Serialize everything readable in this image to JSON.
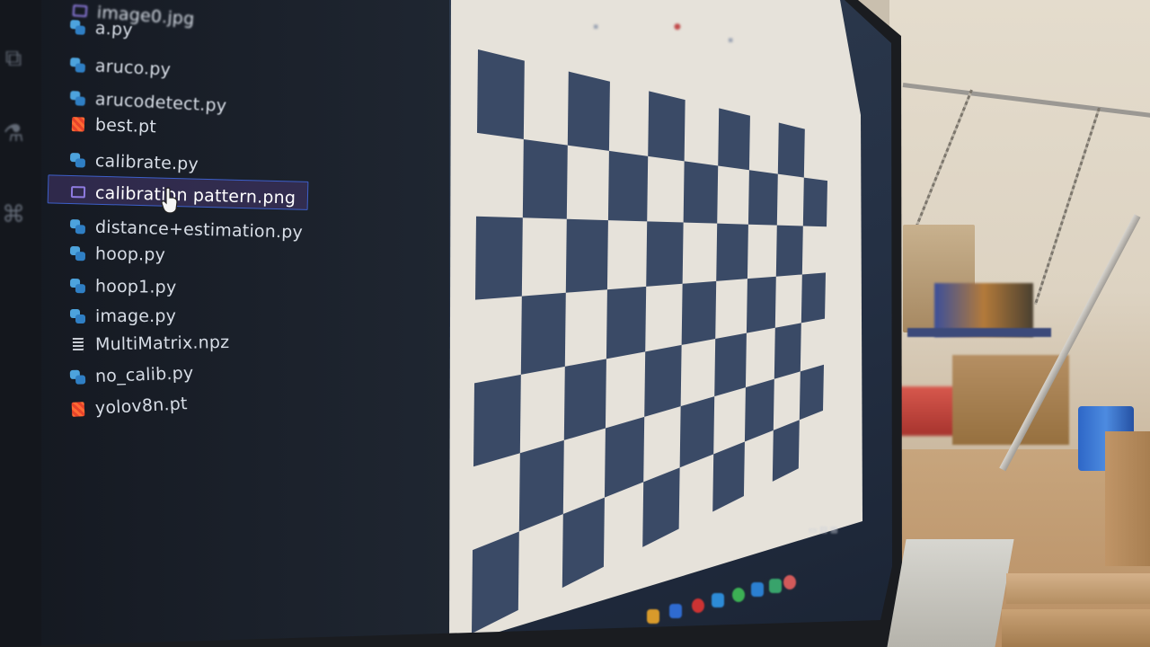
{
  "explorer": {
    "files": [
      {
        "name": "image0.jpg",
        "icon": "image-icon"
      },
      {
        "name": "a.py",
        "icon": "python-icon"
      },
      {
        "name": "aruco.py",
        "icon": "python-icon"
      },
      {
        "name": "arucodetect.py",
        "icon": "python-icon"
      },
      {
        "name": "best.pt",
        "icon": "pytorch-icon"
      },
      {
        "name": "calibrate.py",
        "icon": "python-icon"
      },
      {
        "name": "calibration pattern.png",
        "icon": "image-icon"
      },
      {
        "name": "distance+estimation.py",
        "icon": "python-icon"
      },
      {
        "name": "hoop.py",
        "icon": "python-icon"
      },
      {
        "name": "hoop1.py",
        "icon": "python-icon"
      },
      {
        "name": "image.py",
        "icon": "python-icon"
      },
      {
        "name": "MultiMatrix.npz",
        "icon": "file-lines-icon"
      },
      {
        "name": "no_calib.py",
        "icon": "python-icon"
      },
      {
        "name": "yolov8n.pt",
        "icon": "pytorch-icon"
      }
    ],
    "selected_file": "calibration pattern.png"
  },
  "viewer": {
    "image": "calibration pattern.png",
    "pattern": {
      "rows": 7,
      "cols": 10,
      "dark_color": "#3a4a66",
      "light_color": "#e6e2da"
    }
  },
  "colors": {
    "selection_border": "#3d5fc9",
    "python_icon": "#4da3dd",
    "pytorch_icon": "#ff6a33"
  }
}
